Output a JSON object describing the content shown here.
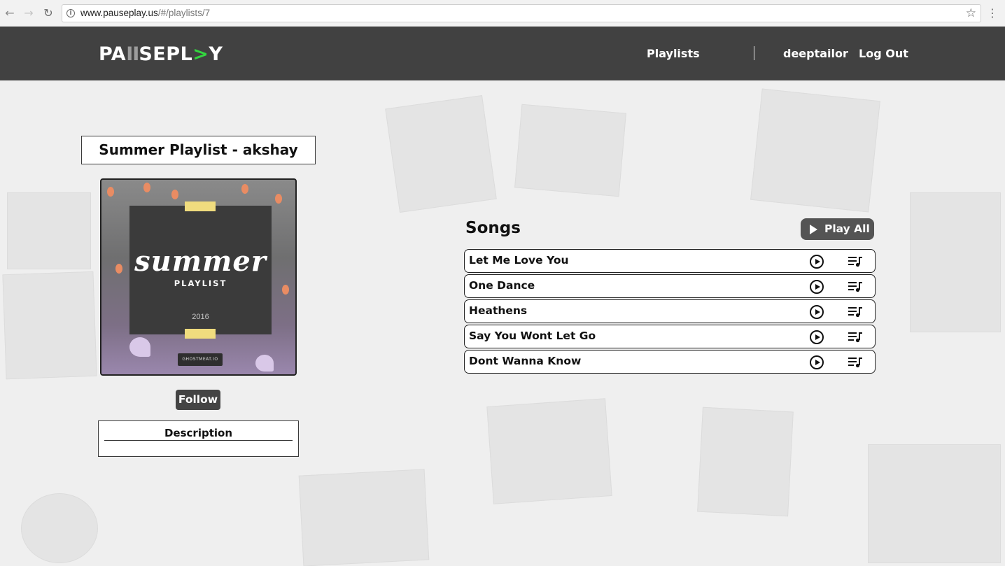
{
  "browser": {
    "url_host": "www.pauseplay.us",
    "url_path": "/#/playlists/7"
  },
  "header": {
    "logo": {
      "pa": "PA",
      "bars": "II",
      "sepl": "SEPL",
      "arrow": ">",
      "y": "Y"
    },
    "nav": {
      "playlists": "Playlists",
      "username": "deeptailor",
      "logout": "Log Out"
    }
  },
  "playlist": {
    "title": "Summer Playlist - akshay",
    "cover": {
      "script": "summer",
      "subtitle": "PLAYLIST",
      "year": "2016",
      "credit": "GHOSTMEAT.IO"
    },
    "follow_label": "Follow",
    "description_label": "Description"
  },
  "songs": {
    "heading": "Songs",
    "play_all_label": "Play All",
    "items": [
      {
        "title": "Let Me Love You"
      },
      {
        "title": "One Dance"
      },
      {
        "title": "Heathens"
      },
      {
        "title": "Say You Wont Let Go"
      },
      {
        "title": "Dont Wanna Know"
      }
    ]
  },
  "colors": {
    "header_bg": "#414141",
    "logo_accent": "#33d63f",
    "button_bg": "#545454"
  }
}
